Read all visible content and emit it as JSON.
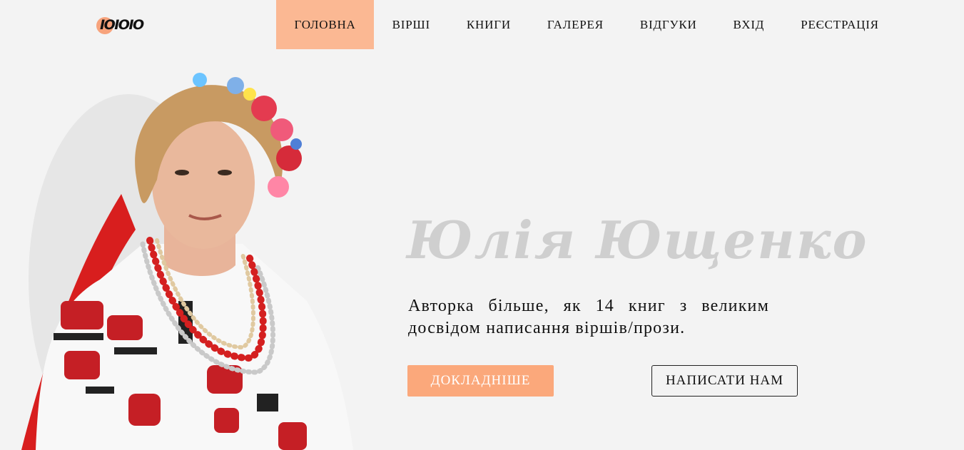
{
  "header": {
    "logo_text": "IOIOIO",
    "nav": [
      {
        "label": "ГОЛОВНА",
        "active": true
      },
      {
        "label": "ВІРШІ",
        "active": false
      },
      {
        "label": "КНИГИ",
        "active": false
      },
      {
        "label": "ГАЛЕРЕЯ",
        "active": false
      },
      {
        "label": "ВІДГУКИ",
        "active": false
      },
      {
        "label": "ВХІД",
        "active": false
      },
      {
        "label": "РЕЄСТРАЦІЯ",
        "active": false
      }
    ]
  },
  "hero": {
    "name": "Юлія Ющенко",
    "description": "Авторка більше, як 14 книг з великим досвідом написання віршів/прози.",
    "more_button": "ДОКЛАДНІШЕ",
    "write_button": "НАПИСАТИ НАМ"
  },
  "colors": {
    "accent": "#fba87b",
    "nav_active": "#fbb893",
    "background": "#f3f3f3",
    "name_text": "#cfcfcf"
  },
  "icons": {
    "logo": "logo-mark"
  }
}
